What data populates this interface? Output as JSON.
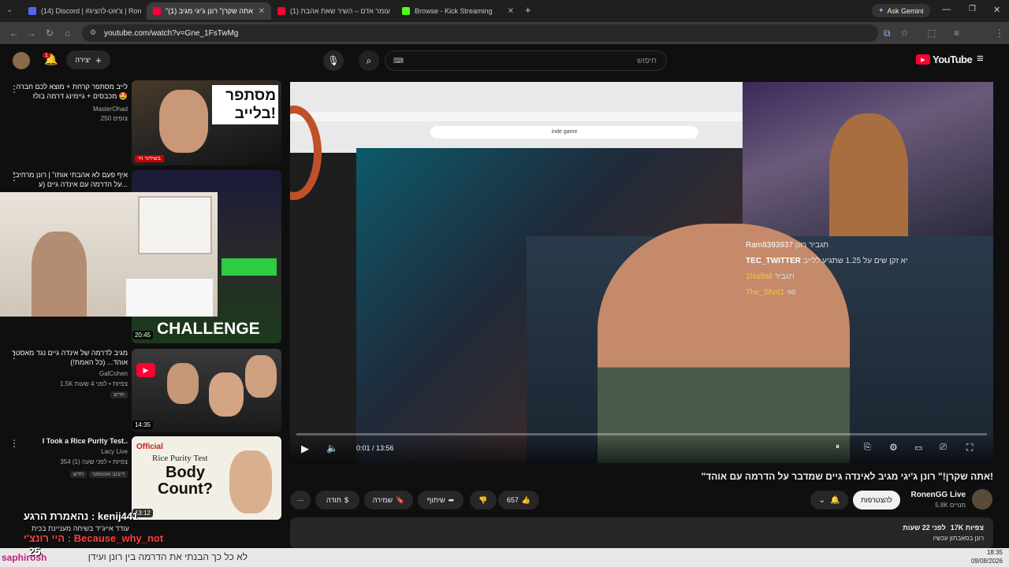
{
  "browser": {
    "tabs": [
      {
        "label": "(14) Discord | #צ'אט-להציג | Ron",
        "favicon_color": "#5865F2"
      },
      {
        "label": "\"אתה שקרן\" רונן ג'יגי מגיב (1)",
        "favicon_color": "#ff0033"
      },
      {
        "label": "(1) עומר אדם – השיר שאת אהבת",
        "favicon_color": "#ff0033"
      },
      {
        "label": "Browse - Kick Streaming",
        "favicon_color": "#53fc18"
      }
    ],
    "ask_gemini": "Ask Gemini",
    "url": "youtube.com/watch?v=Gne_1FsTwMg"
  },
  "youtube": {
    "logo": "YouTube",
    "search_placeholder": "חיפוש",
    "create_label": "יצירה",
    "notif_count": "1"
  },
  "sidebar": [
    {
      "title": "לייב מסתפר קרחת + מוצא לכם חברה מכבסים + גיימינג דרמה בולז 🤩",
      "channel": "MasterOhad",
      "meta": "250 צופים",
      "live_badge": "בשידור חי",
      "thumb_text": "מסתפר בלייב!"
    },
    {
      "title": "\"איף פעם לא אהבתי אותו\" | רונן מרחיב על הדרמה עם אינדה גיים (ע...",
      "channel": "",
      "meta": "",
      "duration": "20:45",
      "thumb_text": "CHALLENGE"
    },
    {
      "title": "מגיב לדרמה של אינדה גיים נגד מאסטר אוהד... (כל האמת!)",
      "channel": "GalCohen",
      "meta": "1.5K צפיות • לפני 4 שעות",
      "chip": "חדש",
      "duration": "14:35"
    },
    {
      "title": "I Took a Rice Purity Test..",
      "channel": "Lacy Live",
      "meta": "354 צפיות • לפני שעה (1)",
      "chip": "חדש",
      "chip2": "דיבוב אוטומטי",
      "duration": "13:12",
      "thumb_text": "Body Count?",
      "thumb_sub": "Rice Purity Test",
      "thumb_tag": "Official"
    }
  ],
  "player": {
    "time": "0:01 / 13:56",
    "inner_search": "inde game",
    "chat": [
      {
        "user": "Ram8393937",
        "msg": "תגביר רונן"
      },
      {
        "user": "TEC_TWITTER",
        "msg": "יא זקן שים על 1.25 שתגיע ללייב"
      },
      {
        "user": "1Naftali",
        "msg": "תגביר"
      },
      {
        "user": "The_Shot1",
        "msg": "ואי"
      }
    ]
  },
  "video": {
    "title": "\"אתה שקרן!\" רונן ג'יגי מגיב לאינדה גיים שמדבר על הדרמה עם אוהד!",
    "channel": "RonenGG Live",
    "subs": "5.8K מנויים",
    "subscribe": "להצטרפות",
    "likes": "657",
    "share": "שיתוף",
    "save": "שמירה",
    "thanks": "תודה",
    "views": "17K צפיות",
    "ago": "לפני 22 שעות",
    "desc": "רונן בסאבתון עכשיו"
  },
  "overlay": {
    "line1": "נהאמרת הרגע : kenij441",
    "line2": "עודד אייג'יד בשיחה מעניינת בכית",
    "line3": "היי רונצ'י : Because_why_not",
    "count": "25",
    "ticker": "לא כל כך הבנתי את הדרמה בין רונן ועידן",
    "ticker_user": "saphirosh"
  },
  "taskbar": {
    "time": "18:35",
    "date": "09/08/2026"
  }
}
